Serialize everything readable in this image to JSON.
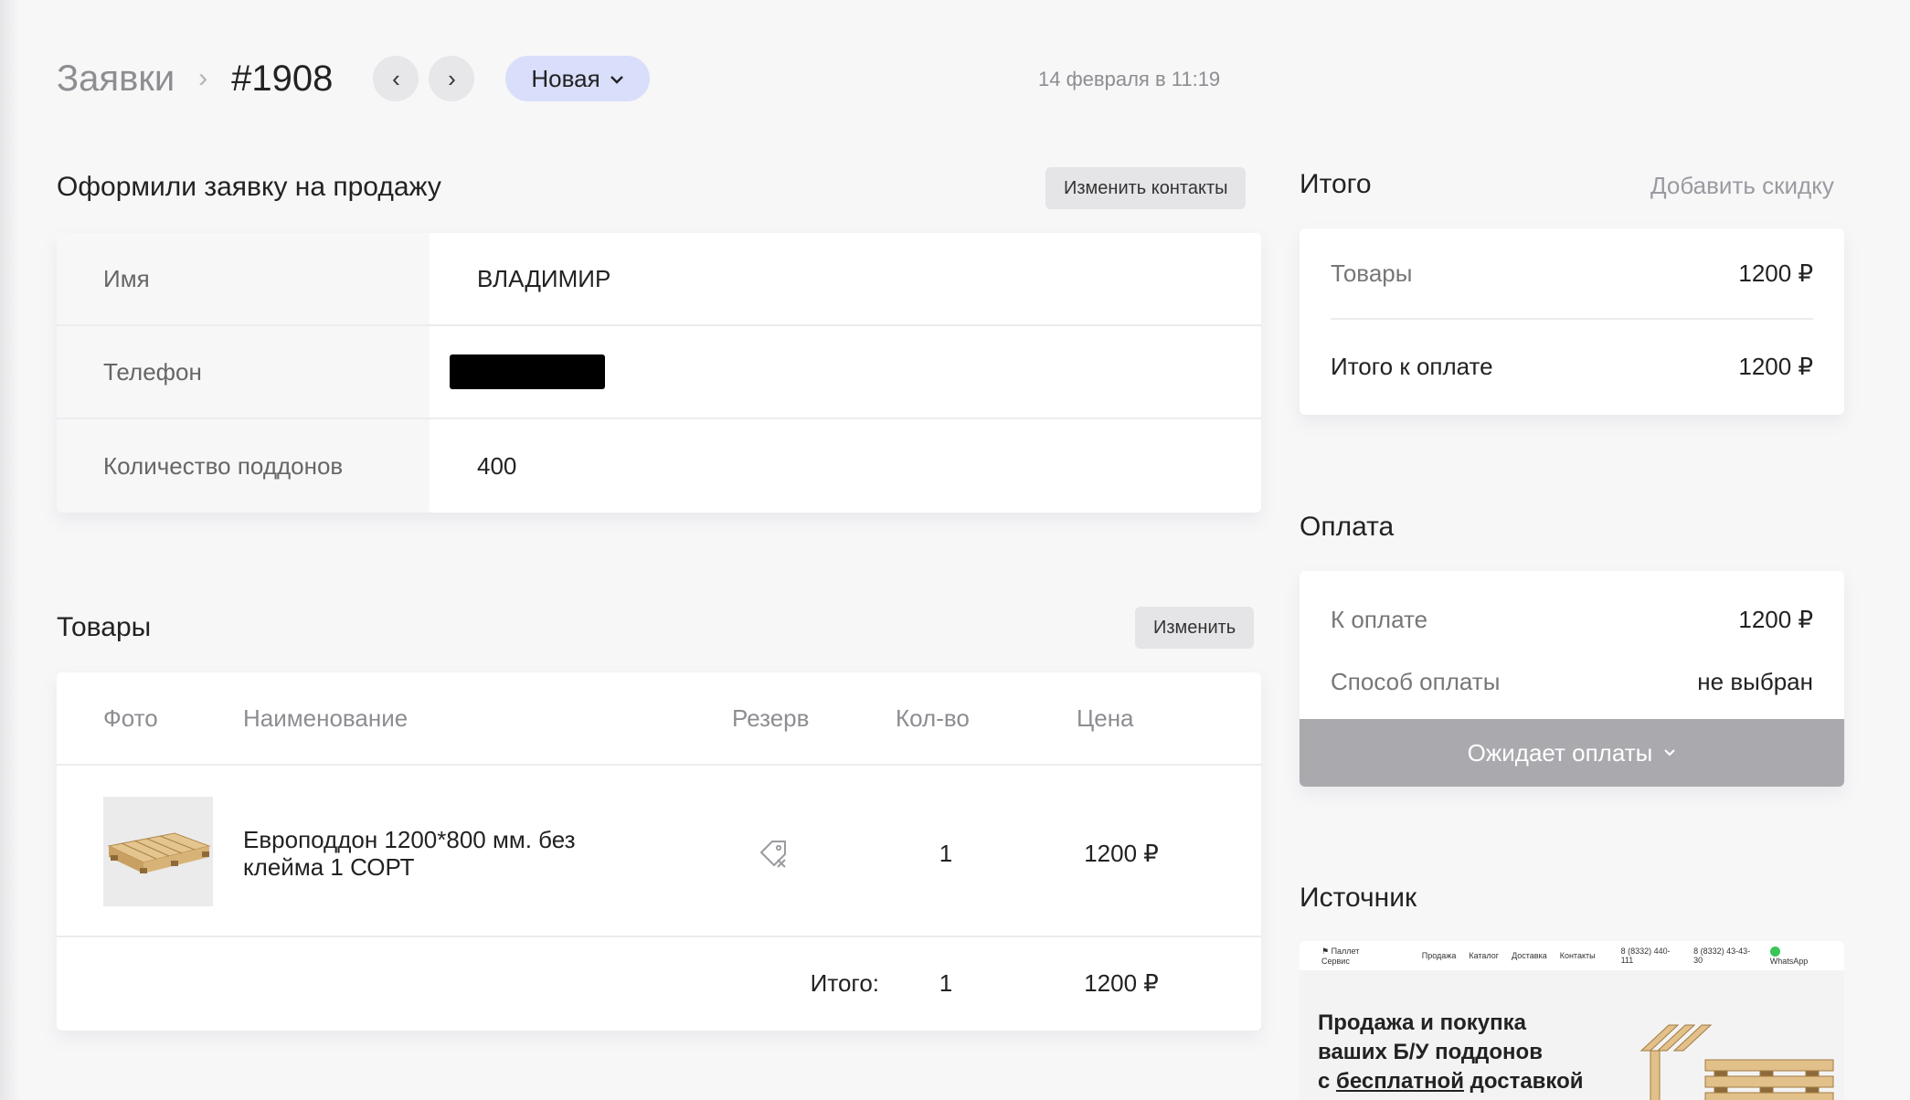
{
  "header": {
    "breadcrumb": "Заявки",
    "separator": "›",
    "order_number": "#1908",
    "prev_icon": "‹",
    "next_icon": "›",
    "status": "Новая",
    "date": "14 февраля в 11:19"
  },
  "contacts": {
    "title": "Оформили заявку на продажу",
    "edit_label": "Изменить контакты",
    "rows": [
      {
        "label": "Имя",
        "value": "ВЛАДИМИР"
      },
      {
        "label": "Телефон",
        "value": ""
      },
      {
        "label": "Количество поддонов",
        "value": "400"
      }
    ]
  },
  "goods": {
    "title": "Товары",
    "edit_label": "Изменить",
    "columns": {
      "photo": "Фото",
      "name": "Наименование",
      "reserve": "Резерв",
      "qty": "Кол-во",
      "price": "Цена"
    },
    "items": [
      {
        "name": "Европоддон 1200*800 мм. без клейма 1 СОРТ",
        "qty": "1",
        "price": "1200 ₽",
        "reserve_icon": "tag-remove-icon"
      }
    ],
    "total_label": "Итого:",
    "total_qty": "1",
    "total_price": "1200 ₽"
  },
  "summary": {
    "title": "Итого",
    "discount_link": "Добавить скидку",
    "goods_label": "Товары",
    "goods_value": "1200 ₽",
    "to_pay_label": "Итого к оплате",
    "to_pay_value": "1200 ₽"
  },
  "payment": {
    "title": "Оплата",
    "amount_label": "К оплате",
    "amount_value": "1200 ₽",
    "method_label": "Способ оплаты",
    "method_value": "не выбран",
    "status_button": "Ожидает оплаты"
  },
  "source": {
    "title": "Источник",
    "site_name": "Паллет Сервис",
    "menu": [
      "Продажа",
      "Каталог",
      "Доставка",
      "Контакты"
    ],
    "phone1": "8 (8332) 440-111",
    "phone2": "8 (8332) 43-43-30",
    "whatsapp": "WhatsApp",
    "headline_1": "Продажа и покупка",
    "headline_2": "ваших Б/У поддонов",
    "headline_3a": "с ",
    "headline_3b": "бесплатной",
    "headline_3c": " доставкой"
  }
}
